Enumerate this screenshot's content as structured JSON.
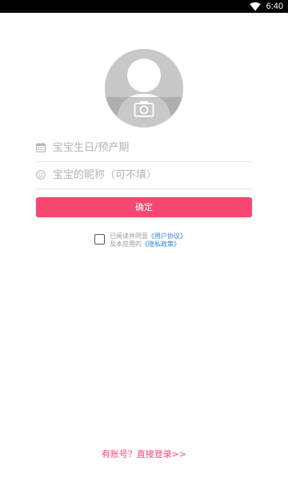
{
  "status_bar": {
    "time": "6:40",
    "icons": [
      "wifi-icon"
    ]
  },
  "avatar": {
    "icon": "camera-icon"
  },
  "form": {
    "birthday": {
      "icon": "calendar-icon",
      "placeholder": "宝宝生日/预产期",
      "value": ""
    },
    "nickname": {
      "icon": "smiley-icon",
      "placeholder": "宝宝的昵称（可不填）",
      "value": ""
    },
    "confirm_label": "确定"
  },
  "agreement": {
    "checked": false,
    "line1_prefix": "已阅读并同意",
    "user_agreement": "《用户协议》",
    "line2_prefix": "及本应用的",
    "privacy_policy": "《隐私政策》"
  },
  "footer": {
    "login_link": "有账号？直接登录>>"
  },
  "colors": {
    "accent": "#f5476f",
    "link": "#2c84d6",
    "placeholder": "#b4b4b4",
    "avatar_bg": "#c8c8c8"
  }
}
